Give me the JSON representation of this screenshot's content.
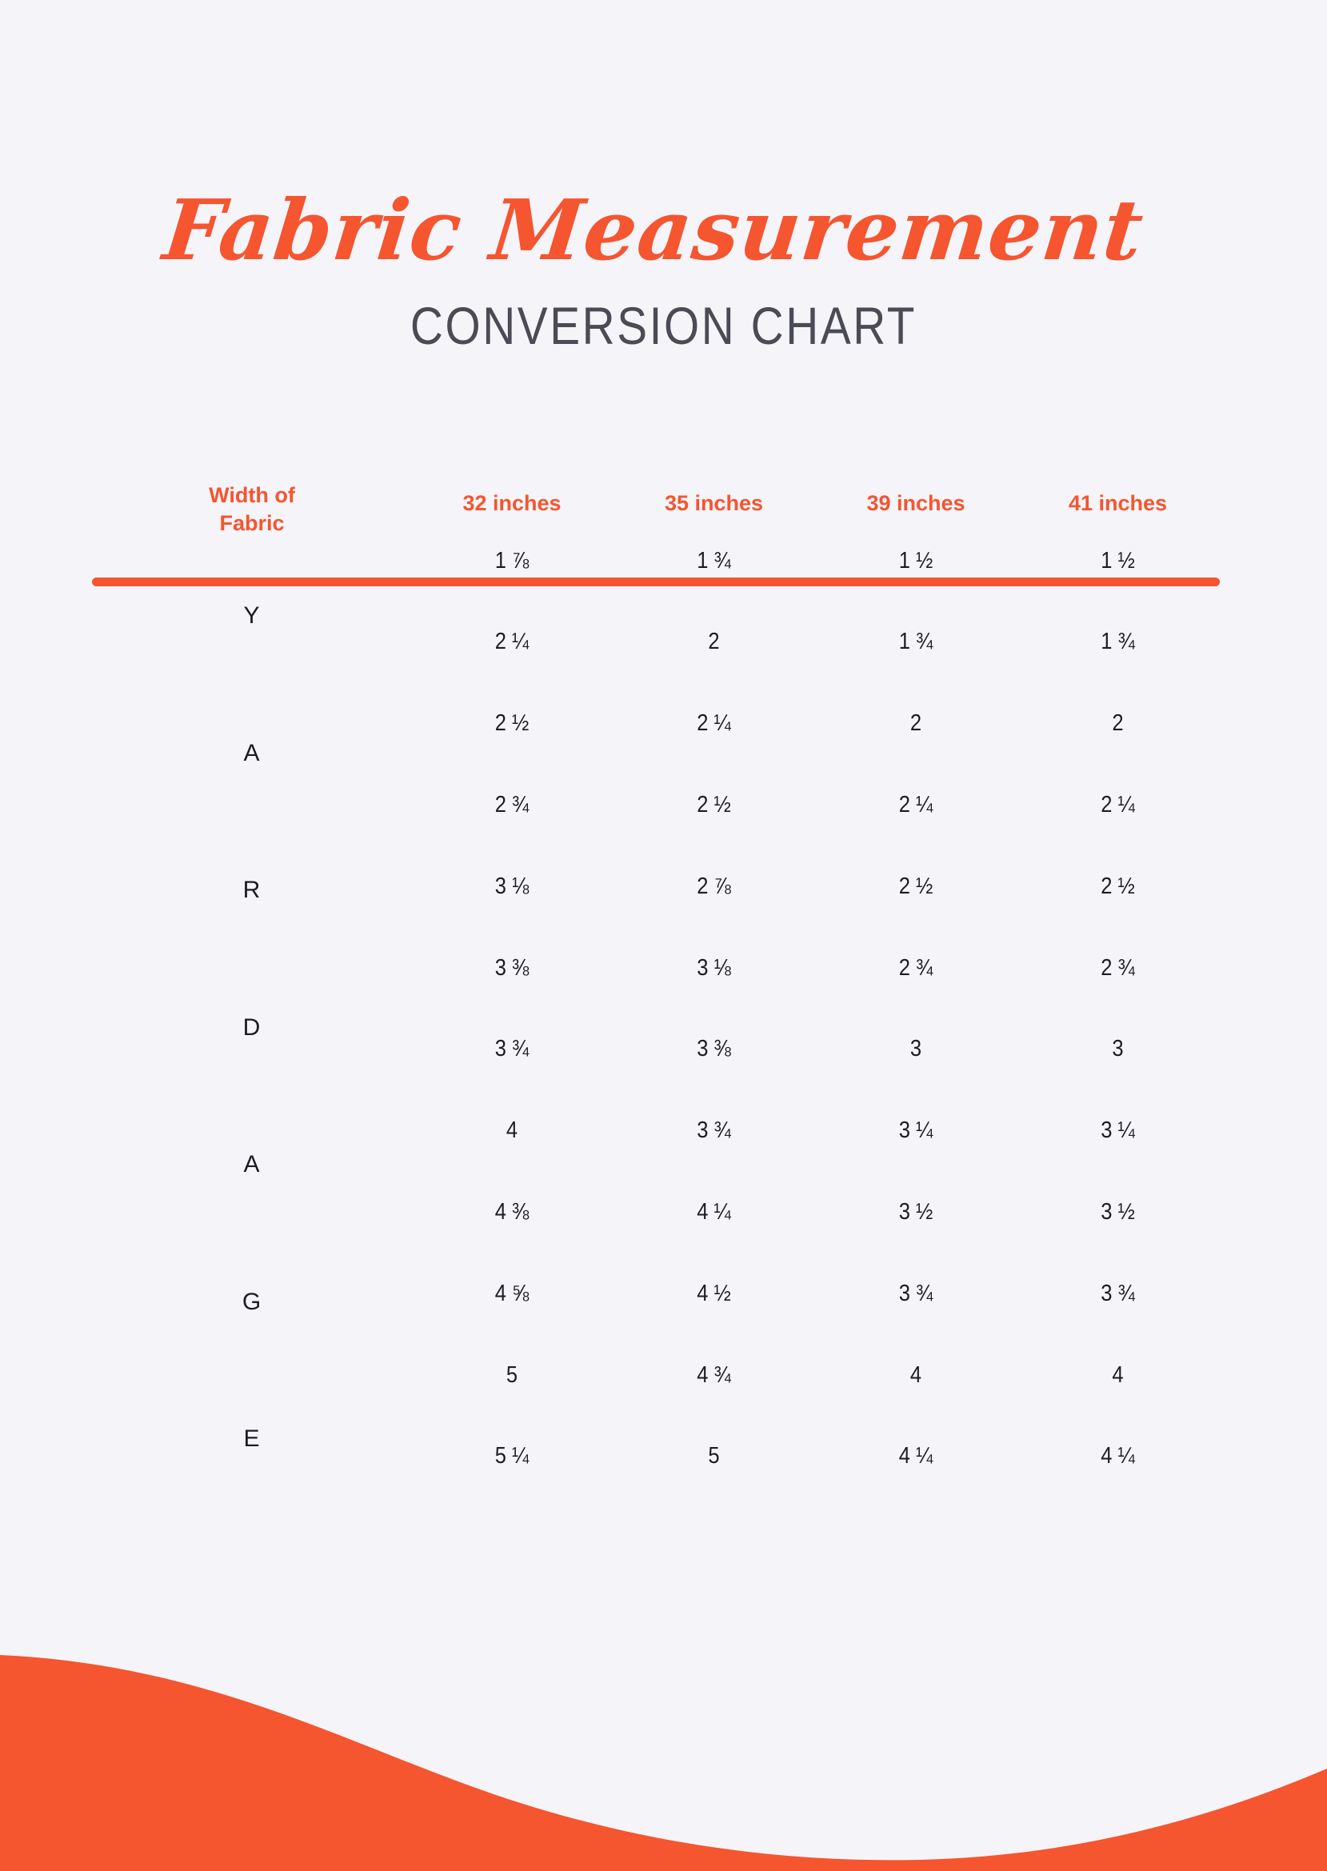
{
  "page": {
    "title_script": "Fabric Measurement",
    "title_sub": "CONVERSION CHART",
    "accent_color": "#F5552F",
    "background_color": "#F5F4F9",
    "text_color": "#1C1C22",
    "subtitle_color": "#4B4B55"
  },
  "side_label": {
    "text": "YARDAGE",
    "letters": [
      "Y",
      "A",
      "R",
      "D",
      "A",
      "G",
      "E"
    ]
  },
  "chart_data": {
    "type": "table",
    "title": "Fabric Measurement Conversion Chart",
    "row_axis_label": "YARDAGE",
    "columns": [
      "Width of Fabric",
      "32 inches",
      "35 inches",
      "39 inches",
      "41 inches"
    ],
    "categories": [
      "32 inches",
      "35 inches",
      "39 inches",
      "41 inches"
    ],
    "rows": [
      [
        "1 ⅞",
        "1 ¾",
        "1 ½",
        "1 ½"
      ],
      [
        "2 ¼",
        "2",
        "1 ¾",
        "1 ¾"
      ],
      [
        "2 ½",
        "2 ¼",
        "2",
        "2"
      ],
      [
        "2 ¾",
        "2 ½",
        "2 ¼",
        "2 ¼"
      ],
      [
        "3 ⅛",
        "2 ⅞",
        "2 ½",
        "2 ½"
      ],
      [
        "3 ⅜",
        "3 ⅛",
        "2 ¾",
        "2 ¾"
      ],
      [
        "3 ¾",
        "3 ⅜",
        "3",
        "3"
      ],
      [
        "4",
        "3 ¾",
        "3 ¼",
        "3 ¼"
      ],
      [
        "4 ⅜",
        "4 ¼",
        "3 ½",
        "3 ½"
      ],
      [
        "4 ⅝",
        "4 ½",
        "3 ¾",
        "3 ¾"
      ],
      [
        "5",
        "4 ¾",
        "4",
        "4"
      ],
      [
        "5 ¼",
        "5",
        "4 ¼",
        "4 ¼"
      ]
    ],
    "series": [
      {
        "name": "32 inches",
        "values": [
          "1 ⅞",
          "2 ¼",
          "2 ½",
          "2 ¾",
          "3 ⅛",
          "3 ⅜",
          "3 ¾",
          "4",
          "4 ⅜",
          "4 ⅝",
          "5",
          "5 ¼"
        ]
      },
      {
        "name": "35 inches",
        "values": [
          "1 ¾",
          "2",
          "2 ¼",
          "2 ½",
          "2 ⅞",
          "3 ⅛",
          "3 ⅜",
          "3 ¾",
          "4 ¼",
          "4 ½",
          "4 ¾",
          "5"
        ]
      },
      {
        "name": "39 inches",
        "values": [
          "1 ½",
          "1 ¾",
          "2",
          "2 ¼",
          "2 ½",
          "2 ¾",
          "3",
          "3 ¼",
          "3 ½",
          "3 ¾",
          "4",
          "4 ¼"
        ]
      },
      {
        "name": "41 inches",
        "values": [
          "1 ½",
          "1 ¾",
          "2",
          "2 ¼",
          "2 ½",
          "2 ¾",
          "3",
          "3 ¼",
          "3 ½",
          "3 ¾",
          "4",
          "4 ¼"
        ]
      }
    ],
    "grid": false,
    "legend": "none"
  }
}
